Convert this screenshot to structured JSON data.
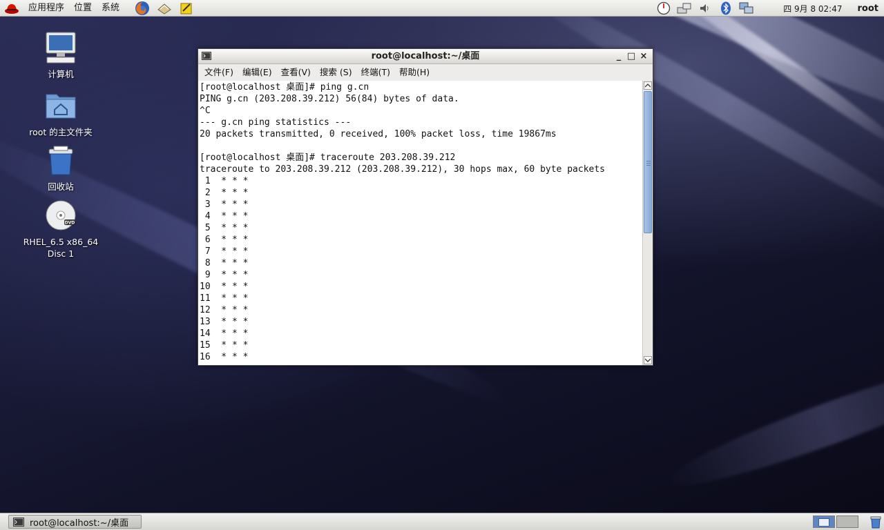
{
  "top_panel": {
    "menus": [
      "应用程序",
      "位置",
      "系统"
    ],
    "launchers": [
      "firefox-icon",
      "mail-icon",
      "note-icon"
    ],
    "tray_icons": [
      "gauge-icon",
      "network-icon",
      "volume-icon",
      "bluetooth-icon",
      "display-icon"
    ],
    "clock": "四 9月  8 02:47",
    "user": "root"
  },
  "desktop_icons": [
    {
      "name": "computer-icon",
      "label": "计算机"
    },
    {
      "name": "home-folder-icon",
      "label": "root 的主文件夹"
    },
    {
      "name": "trash-icon",
      "label": "回收站"
    },
    {
      "name": "dvd-icon",
      "label": "RHEL_6.5 x86_64\nDisc 1"
    }
  ],
  "window": {
    "title": "root@localhost:~/桌面",
    "controls": {
      "minimize": "_",
      "maximize": "□",
      "close": "×"
    },
    "menu": [
      "文件(F)",
      "编辑(E)",
      "查看(V)",
      "搜索 (S)",
      "终端(T)",
      "帮助(H)"
    ],
    "terminal_lines": [
      "[root@localhost 桌面]# ping g.cn",
      "PING g.cn (203.208.39.212) 56(84) bytes of data.",
      "^C",
      "--- g.cn ping statistics ---",
      "20 packets transmitted, 0 received, 100% packet loss, time 19867ms",
      "",
      "[root@localhost 桌面]# traceroute 203.208.39.212",
      "traceroute to 203.208.39.212 (203.208.39.212), 30 hops max, 60 byte packets",
      " 1  * * *",
      " 2  * * *",
      " 3  * * *",
      " 4  * * *",
      " 5  * * *",
      " 6  * * *",
      " 7  * * *",
      " 8  * * *",
      " 9  * * *",
      "10  * * *",
      "11  * * *",
      "12  * * *",
      "13  * * *",
      "14  * * *",
      "15  * * *",
      "16  * * *"
    ]
  },
  "taskbar": {
    "task_label": "root@localhost:~/桌面",
    "workspaces": 2,
    "active_workspace": 1
  },
  "colors": {
    "panel": "#e6e6e3",
    "scroll_thumb": "#86a9d9",
    "terminal_bg": "#ffffff",
    "terminal_fg": "#111111"
  }
}
